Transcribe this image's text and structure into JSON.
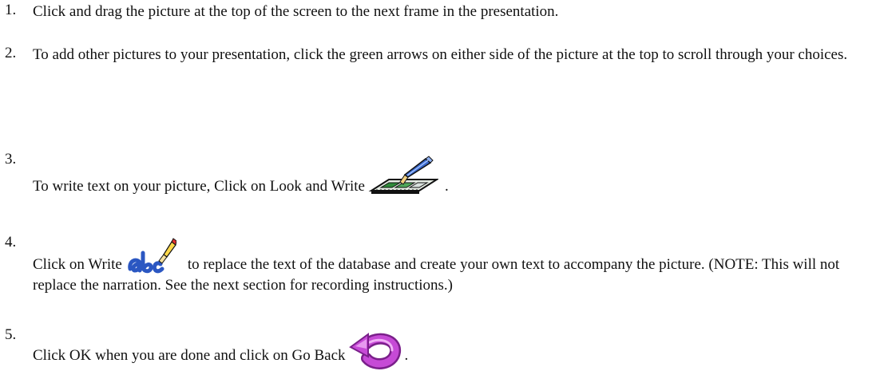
{
  "instructions": [
    {
      "number": "1.",
      "text": "Click and drag the picture at the top of the screen to the next frame in the presentation."
    },
    {
      "number": "2.",
      "text": "To add other pictures to your presentation, click the green arrows on either side of the picture at the top to scroll through your choices."
    },
    {
      "number": "3.",
      "text_before": "To write text on your picture, Click on Look and Write",
      "text_after": ".",
      "icon": "look-and-write-icon"
    },
    {
      "number": "4.",
      "text_before": "Click on Write",
      "text_after": "to replace the text of the database and create your own text to accompany the picture. (NOTE: This will not replace the narration. See the next section for recording instructions.)",
      "icon": "write-abc-pencil-icon"
    },
    {
      "number": "5.",
      "text_before": "Click OK when you are done and click on Go Back",
      "text_after": ".",
      "icon": "go-back-arrow-icon"
    }
  ],
  "colors": {
    "text": "#111111",
    "film_green": "#2f8a3a",
    "pencil_blue": "#3a66c8",
    "abc_blue": "#2b57c2",
    "go_back_magenta": "#c64ad6"
  }
}
